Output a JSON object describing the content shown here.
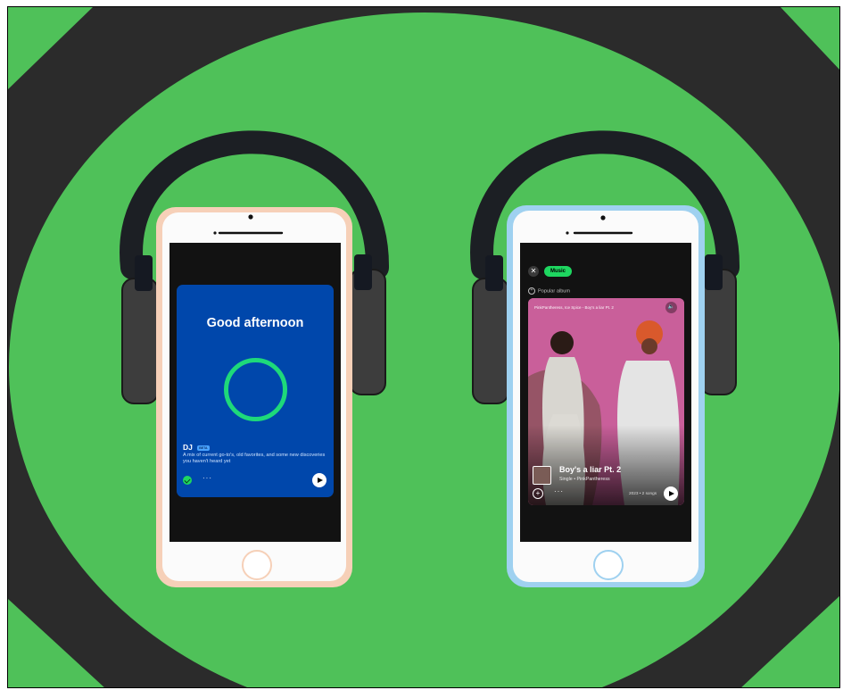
{
  "left_phone": {
    "greeting": "Good afternoon",
    "card_title": "DJ",
    "badge": "BETA",
    "description": "A mix of current go-to's, old favorites, and some new discoveries you haven't heard yet",
    "more": "···",
    "accent": "#1ed760",
    "card_color": "#0047ab"
  },
  "right_phone": {
    "filter_chip": "Music",
    "close_icon": "✕",
    "section_label": "Popular album",
    "artists_line": "PinkPantheress, Ice Spice - Boy's a liar Pt. 2",
    "song_title": "Boy's a liar Pt. 2",
    "song_subtitle": "Single • PinkPantheress",
    "release_meta": "2023 • 2 songs",
    "more": "···",
    "add_icon": "+",
    "speaker_icon": "🔈"
  },
  "colors": {
    "background_green": "#4fc159",
    "background_dark": "#2b2b2b",
    "headphone": "#1c1f24",
    "left_case": "#f6d0b8",
    "right_case": "#9fd1f0"
  }
}
